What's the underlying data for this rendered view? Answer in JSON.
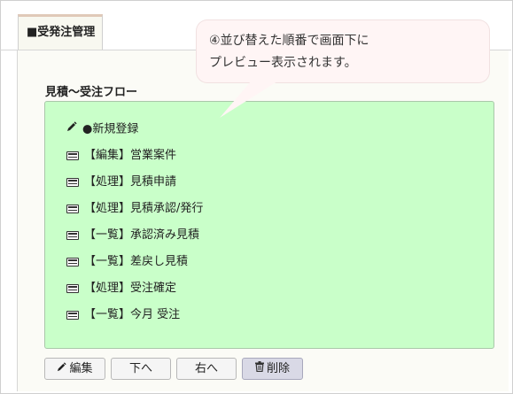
{
  "tab": {
    "label": "■受発注管理"
  },
  "section": {
    "title": "見積〜受注フロー"
  },
  "flow": {
    "items": [
      {
        "label": "●新規登録",
        "icon": "pencil-icon"
      },
      {
        "label": "【編集】営業案件",
        "icon": "list-icon"
      },
      {
        "label": "【処理】見積申請",
        "icon": "list-icon"
      },
      {
        "label": "【処理】見積承認/発行",
        "icon": "list-icon"
      },
      {
        "label": "【一覧】承認済み見積",
        "icon": "list-icon"
      },
      {
        "label": "【一覧】差戻し見積",
        "icon": "list-icon"
      },
      {
        "label": "【処理】受注確定",
        "icon": "list-icon"
      },
      {
        "label": "【一覧】今月 受注",
        "icon": "list-icon"
      }
    ]
  },
  "buttons": {
    "edit": "編集",
    "down": "下へ",
    "right": "右へ",
    "delete": "削除"
  },
  "callout": {
    "line1": "④並び替えた順番で画面下に",
    "line2": "プレビュー表示されます。"
  }
}
